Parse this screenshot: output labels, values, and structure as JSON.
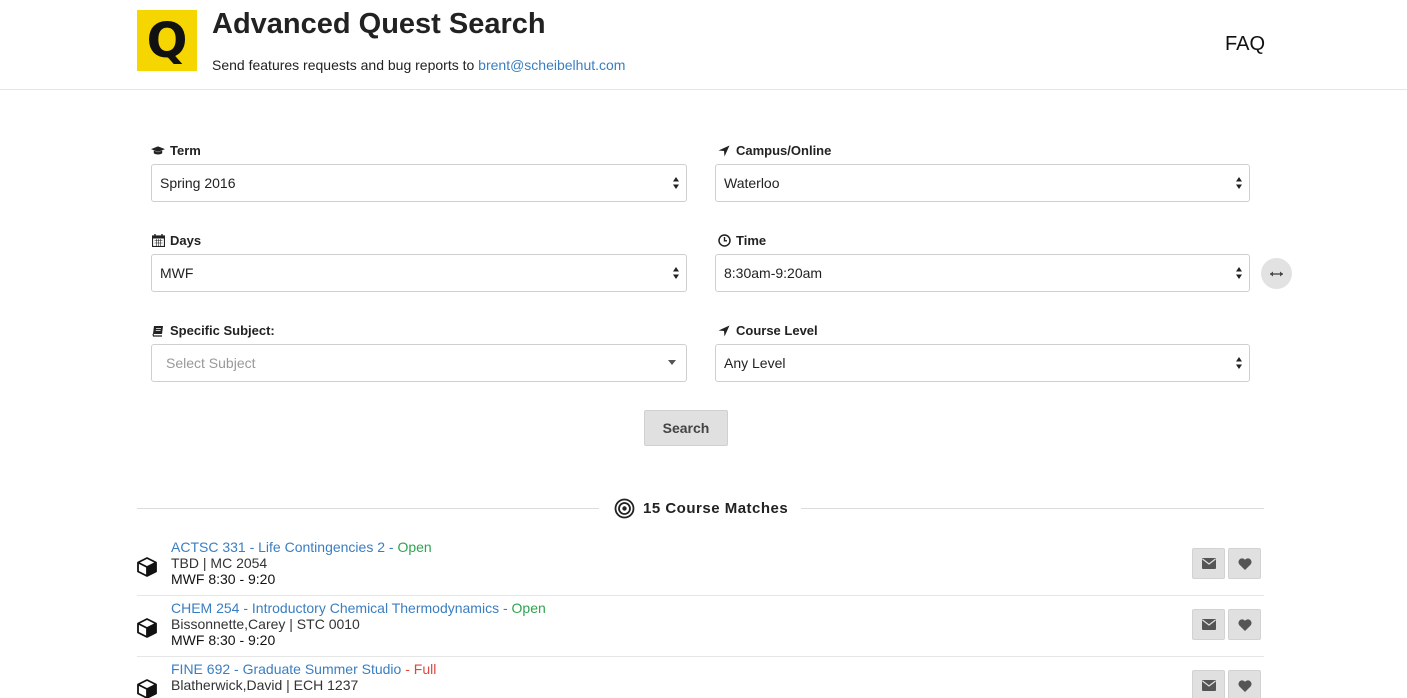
{
  "header": {
    "logo_letter": "Q",
    "title": "Advanced Quest Search",
    "subtitle_prefix": "Send features requests and bug reports to",
    "contact_email": "brent@scheibelhut.com",
    "faq_label": "FAQ"
  },
  "form": {
    "term": {
      "label": "Term",
      "icon": "graduation-cap-icon",
      "value": "Spring 2016"
    },
    "campus": {
      "label": "Campus/Online",
      "icon": "location-arrow-icon",
      "value": "Waterloo"
    },
    "days": {
      "label": "Days",
      "icon": "calendar-icon",
      "value": "MWF"
    },
    "time": {
      "label": "Time",
      "icon": "clock-icon",
      "value": "8:30am-9:20am"
    },
    "subject": {
      "label": "Specific Subject:",
      "icon": "book-icon",
      "placeholder": "Select Subject"
    },
    "level": {
      "label": "Course Level",
      "icon": "location-arrow-icon",
      "value": "Any Level"
    },
    "search_label": "Search"
  },
  "results": {
    "count_label": "15 Course Matches",
    "courses": [
      {
        "title": "ACTSC 331 - Life Contingencies 2",
        "separator": "-",
        "status": "Open",
        "meta": "TBD | MC 2054",
        "schedule": "MWF 8:30 - 9:20"
      },
      {
        "title": "CHEM 254 - Introductory Chemical Thermodynamics",
        "separator": "-",
        "status": "Open",
        "meta": "Bissonnette,Carey | STC 0010",
        "schedule": "MWF 8:30 - 9:20"
      },
      {
        "title": "FINE 692 - Graduate Summer Studio",
        "separator": "-",
        "status": "Full",
        "meta": "Blatherwick,David | ECH 1237",
        "schedule": ""
      }
    ]
  },
  "colors": {
    "accent": "#3a7ec1",
    "open": "#2ea44f",
    "full": "#e0463f",
    "logo": "#f6d600"
  }
}
